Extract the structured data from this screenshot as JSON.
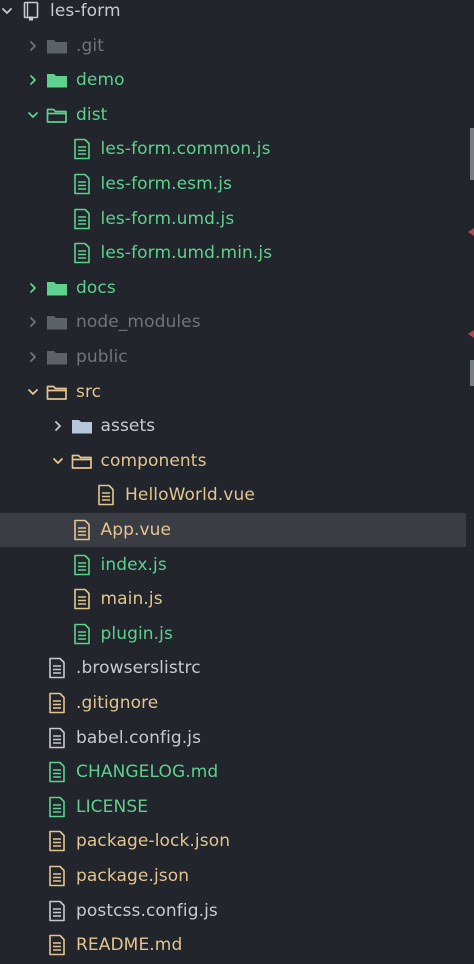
{
  "root": {
    "label": "les-form",
    "icon": "repo-icon",
    "expanded": true
  },
  "colors": {
    "background": "#22252b",
    "selected_row": "#3a3d44",
    "green": "#5dd18e",
    "amber": "#e3c58f",
    "grey": "#70747c",
    "white": "#c7cad0",
    "folder_green": "#5dd18e",
    "folder_amber": "#e3c58f",
    "folder_grey": "#5d6168",
    "folder_blue": "#b8c6dc",
    "scroll_marker": "#7b7f86",
    "error_marker": "#b4474e"
  },
  "items": [
    {
      "label": ".git",
      "type": "folder",
      "depth": 1,
      "state": "collapsed",
      "color": "grey"
    },
    {
      "label": "demo",
      "type": "folder",
      "depth": 1,
      "state": "collapsed",
      "color": "green"
    },
    {
      "label": "dist",
      "type": "folder",
      "depth": 1,
      "state": "expanded",
      "color": "green"
    },
    {
      "label": "les-form.common.js",
      "type": "file",
      "depth": 2,
      "color": "green"
    },
    {
      "label": "les-form.esm.js",
      "type": "file",
      "depth": 2,
      "color": "green"
    },
    {
      "label": "les-form.umd.js",
      "type": "file",
      "depth": 2,
      "color": "green"
    },
    {
      "label": "les-form.umd.min.js",
      "type": "file",
      "depth": 2,
      "color": "green"
    },
    {
      "label": "docs",
      "type": "folder",
      "depth": 1,
      "state": "collapsed",
      "color": "green"
    },
    {
      "label": "node_modules",
      "type": "folder",
      "depth": 1,
      "state": "collapsed",
      "color": "grey"
    },
    {
      "label": "public",
      "type": "folder",
      "depth": 1,
      "state": "collapsed",
      "color": "grey"
    },
    {
      "label": "src",
      "type": "folder",
      "depth": 1,
      "state": "expanded",
      "color": "amber"
    },
    {
      "label": "assets",
      "type": "folder",
      "depth": 2,
      "state": "collapsed",
      "color": "white"
    },
    {
      "label": "components",
      "type": "folder",
      "depth": 2,
      "state": "expanded",
      "color": "amber"
    },
    {
      "label": "HelloWorld.vue",
      "type": "file",
      "depth": 3,
      "color": "amber"
    },
    {
      "label": "App.vue",
      "type": "file",
      "depth": 2,
      "color": "amber",
      "selected": true
    },
    {
      "label": "index.js",
      "type": "file",
      "depth": 2,
      "color": "green"
    },
    {
      "label": "main.js",
      "type": "file",
      "depth": 2,
      "color": "amber"
    },
    {
      "label": "plugin.js",
      "type": "file",
      "depth": 2,
      "color": "green"
    },
    {
      "label": ".browserslistrc",
      "type": "file",
      "depth": 1,
      "color": "white"
    },
    {
      "label": ".gitignore",
      "type": "file",
      "depth": 1,
      "color": "amber"
    },
    {
      "label": "babel.config.js",
      "type": "file",
      "depth": 1,
      "color": "white"
    },
    {
      "label": "CHANGELOG.md",
      "type": "file",
      "depth": 1,
      "color": "green"
    },
    {
      "label": "LICENSE",
      "type": "file",
      "depth": 1,
      "color": "green"
    },
    {
      "label": "package-lock.json",
      "type": "file",
      "depth": 1,
      "color": "amber"
    },
    {
      "label": "package.json",
      "type": "file",
      "depth": 1,
      "color": "amber"
    },
    {
      "label": "postcss.config.js",
      "type": "file",
      "depth": 1,
      "color": "white"
    },
    {
      "label": "README.md",
      "type": "file",
      "depth": 1,
      "color": "amber"
    }
  ]
}
